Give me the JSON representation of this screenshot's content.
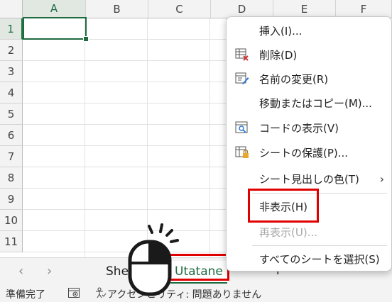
{
  "columns": [
    "A",
    "B",
    "C",
    "D",
    "E",
    "F"
  ],
  "rows": [
    "1",
    "2",
    "3",
    "4",
    "5",
    "6",
    "7",
    "8",
    "9",
    "10",
    "11"
  ],
  "sheet_tabs": [
    "Shee",
    "Utatane"
  ],
  "add_sheet": "+",
  "nav": {
    "prev": "‹",
    "next": "›"
  },
  "context_menu": {
    "items": [
      {
        "label": "挿入(I)...",
        "icon": "",
        "disabled": false
      },
      {
        "label": "削除(D)",
        "icon": "delete-sheet-icon",
        "disabled": false
      },
      {
        "label": "名前の変更(R)",
        "icon": "rename-icon",
        "disabled": false
      },
      {
        "label": "移動またはコピー(M)...",
        "icon": "",
        "disabled": false
      },
      {
        "label": "コードの表示(V)",
        "icon": "view-code-icon",
        "disabled": false
      },
      {
        "label": "シートの保護(P)...",
        "icon": "protect-sheet-icon",
        "disabled": false
      },
      {
        "label": "シート見出しの色(T)",
        "icon": "",
        "disabled": false,
        "submenu": true
      },
      {
        "label": "非表示(H)",
        "icon": "",
        "disabled": false,
        "highlighted": true
      },
      {
        "label": "再表示(U)...",
        "icon": "",
        "disabled": true
      },
      {
        "label": "すべてのシートを選択(S)",
        "icon": "",
        "disabled": false
      }
    ],
    "submenu_arrow": "›"
  },
  "status": {
    "ready": "準備完了",
    "accessibility": "アクセシビリティ: 問題ありません"
  },
  "colors": {
    "accent": "#1e6b40",
    "highlight_border": "#e00000"
  }
}
